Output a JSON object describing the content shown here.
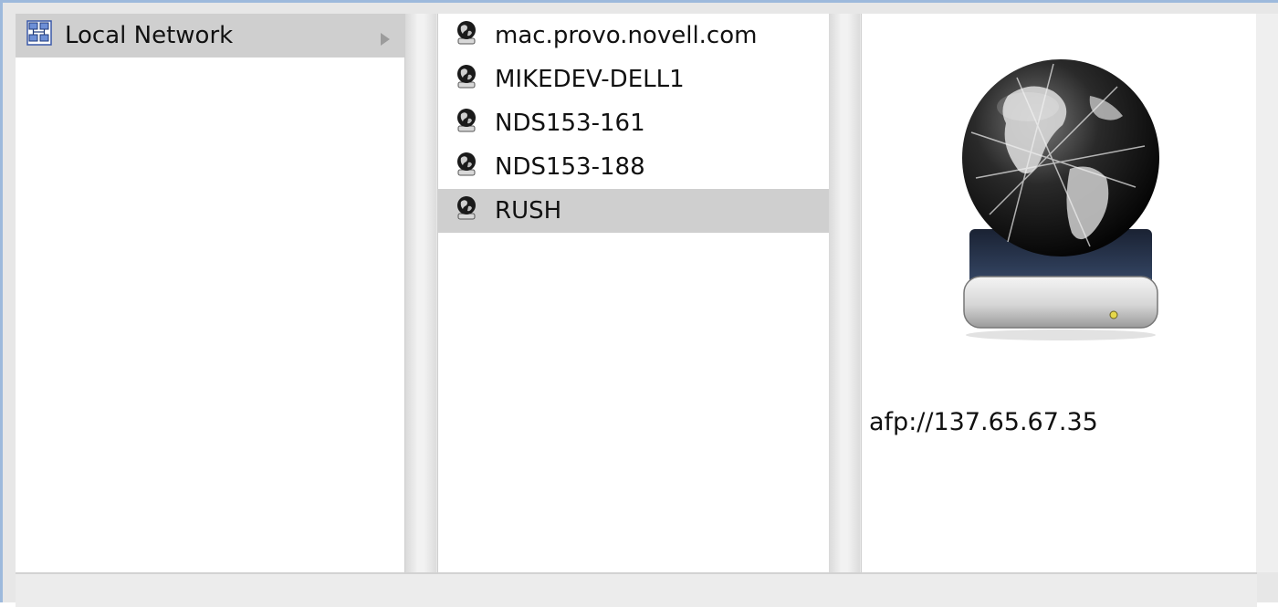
{
  "browser": {
    "sidebar": {
      "items": [
        {
          "label": "Local Network",
          "icon": "network-icon",
          "selected": true,
          "has_children": true
        }
      ]
    },
    "servers": {
      "items": [
        {
          "label": "mac.provo.novell.com",
          "icon": "server-globe-icon",
          "selected": false
        },
        {
          "label": "MIKEDEV-DELL1",
          "icon": "server-globe-icon",
          "selected": false
        },
        {
          "label": "NDS153-161",
          "icon": "server-globe-icon",
          "selected": false
        },
        {
          "label": "NDS153-188",
          "icon": "server-globe-icon",
          "selected": false
        },
        {
          "label": "RUSH",
          "icon": "server-globe-icon",
          "selected": true
        }
      ]
    },
    "preview": {
      "icon": "network-server-icon",
      "address": "afp://137.65.67.35"
    }
  },
  "colors": {
    "selection": "#cfcfcf",
    "frame_accent": "#9db9dc"
  }
}
